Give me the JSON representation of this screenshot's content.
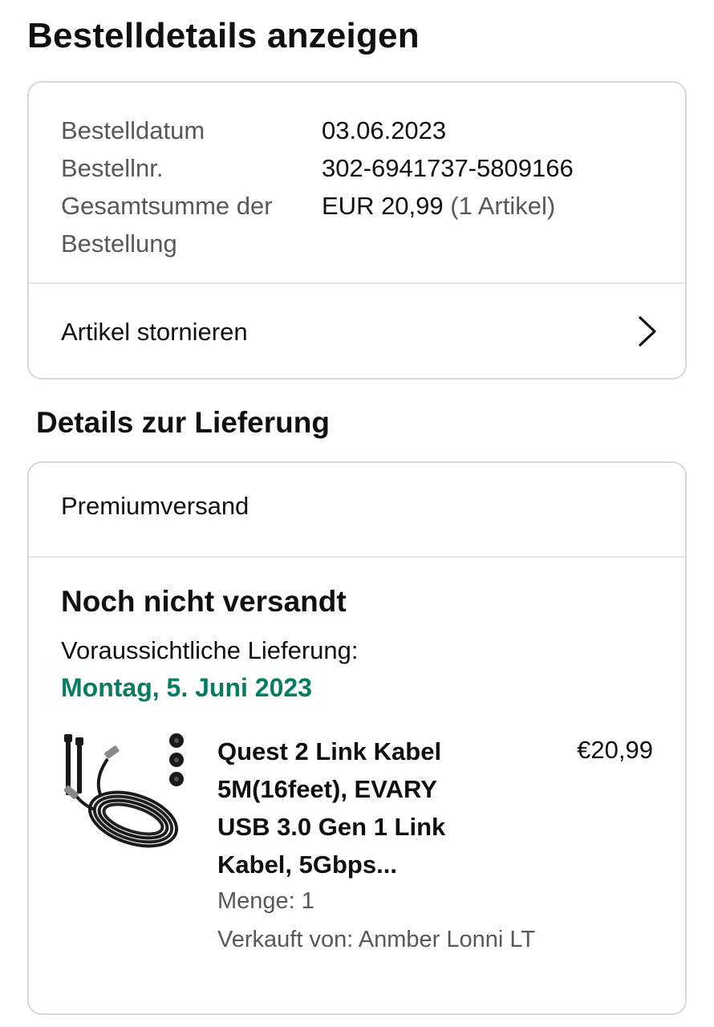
{
  "header": {
    "title": "Bestelldetails anzeigen"
  },
  "order_summary": {
    "rows": [
      {
        "label": "Bestelldatum",
        "value": "03.06.2023"
      },
      {
        "label": "Bestellnr.",
        "value": "302-6941737-5809166"
      },
      {
        "label": "Gesamtsumme der Bestellung",
        "value": "EUR 20,99",
        "value_note": "(1 Artikel)"
      }
    ],
    "cancel_label": "Artikel stornieren",
    "cancel_icon": "chevron-right-icon"
  },
  "delivery": {
    "section_title": "Details zur Lieferung",
    "shipping_method": "Premiumversand",
    "status": "Noch nicht versandt",
    "eta_label": "Voraussichtliche Lieferung:",
    "eta_date": "Montag, 5. Juni 2023",
    "eta_color": "#067D62",
    "item": {
      "image": "usb-link-cable-image",
      "title": "Quest 2 Link Kabel 5M(16feet), EVARY USB 3.0 Gen 1 Link Kabel, 5Gbps...",
      "price": "€20,99",
      "quantity": "Menge: 1",
      "seller": "Verkauft von: Anmber Lonni LT"
    }
  }
}
